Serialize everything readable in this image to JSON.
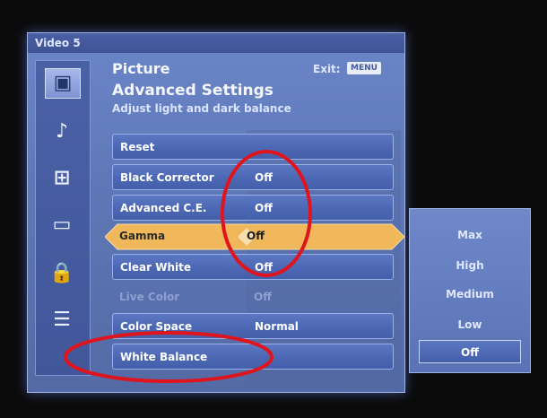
{
  "window": {
    "source_label": "Video 5"
  },
  "sidebar": {
    "icons": [
      {
        "name": "picture-icon",
        "glyph": "▣",
        "active": true
      },
      {
        "name": "music-note-icon",
        "glyph": "♪",
        "active": false
      },
      {
        "name": "screen-size-icon",
        "glyph": "⊞",
        "active": false
      },
      {
        "name": "tv-antenna-icon",
        "glyph": "▭",
        "active": false
      },
      {
        "name": "lock-icon",
        "glyph": "🔒",
        "active": false
      },
      {
        "name": "setup-list-icon",
        "glyph": "☰",
        "active": false
      }
    ]
  },
  "header": {
    "section": "Picture",
    "exit_label": "Exit:",
    "exit_key": "MENU",
    "submenu_title": "Advanced Settings",
    "hint": "Adjust light and dark balance"
  },
  "settings": [
    {
      "label": "Reset",
      "value": ""
    },
    {
      "label": "Black Corrector",
      "value": "Off"
    },
    {
      "label": "Advanced C.E.",
      "value": "Off"
    },
    {
      "label": "Gamma",
      "value": "Off"
    },
    {
      "label": "Clear White",
      "value": "Off"
    },
    {
      "label": "Live Color",
      "value": "Off"
    },
    {
      "label": "Color Space",
      "value": "Normal"
    },
    {
      "label": "White Balance",
      "value": ""
    }
  ],
  "gamma_options": [
    {
      "label": "Max"
    },
    {
      "label": "High"
    },
    {
      "label": "Medium"
    },
    {
      "label": "Low"
    },
    {
      "label": "Off"
    }
  ],
  "colors": {
    "selection_accent": "#f0b85a",
    "annotation_red": "#e0141c",
    "panel_blue": "#5f79b8"
  }
}
